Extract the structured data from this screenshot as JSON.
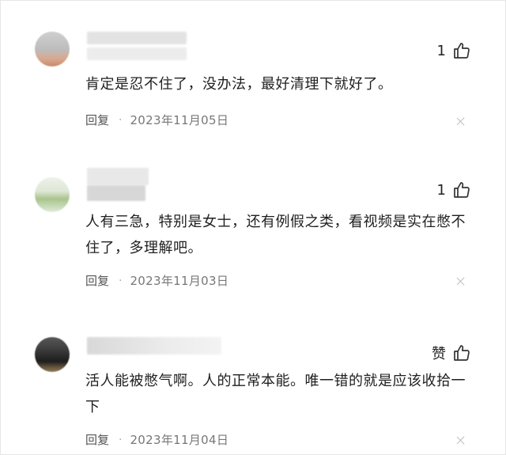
{
  "comments": [
    {
      "like_count": "1",
      "text": "肯定是忍不住了，没办法，最好清理下就好了。",
      "reply_label": "回复",
      "separator": "·",
      "date": "2023年11月05日"
    },
    {
      "like_count": "1",
      "text": "人有三急，特别是女士，还有例假之类，看视频是实在憋不住了，多理解吧。",
      "reply_label": "回复",
      "separator": "·",
      "date": "2023年11月03日"
    },
    {
      "like_count": "赞",
      "text": "活人能被憋气啊。人的正常本能。唯一错的就是应该收拾一下",
      "reply_label": "回复",
      "separator": "·",
      "date": "2023年11月04日"
    }
  ],
  "icons": {
    "like": "thumbs-up-icon",
    "close": "close-icon"
  }
}
